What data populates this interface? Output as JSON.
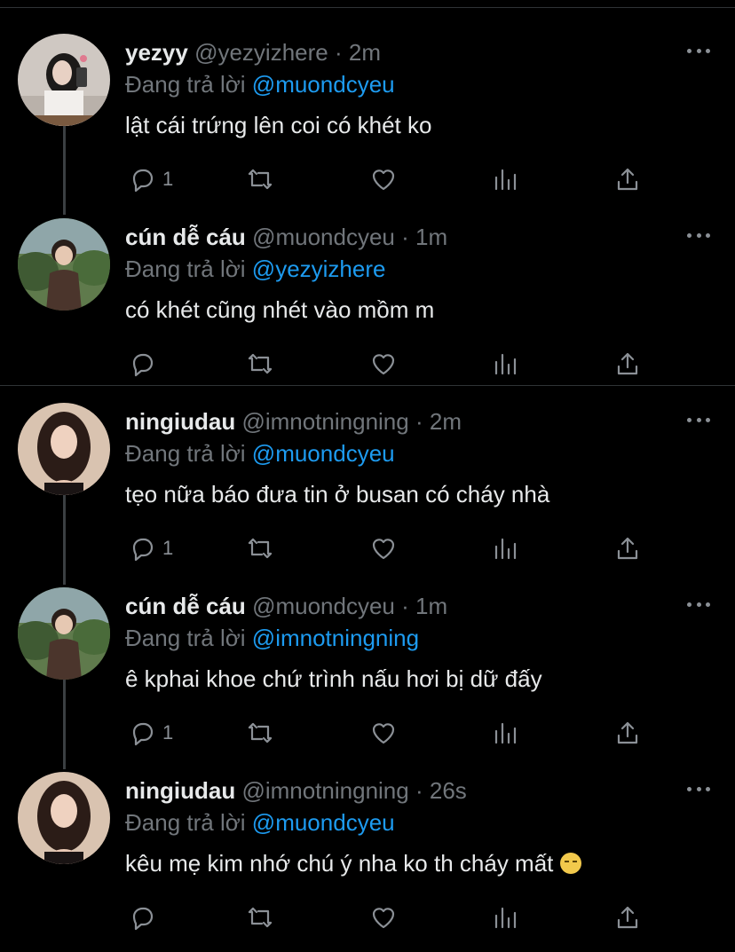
{
  "tweets": [
    {
      "name": "yezyy",
      "handle": "@yezyizhere",
      "dot": "·",
      "time": "2m",
      "replying_prefix": "Đang trả lời",
      "replying_to": "@muondcyeu",
      "text": "lật cái trứng lên coi có khét ko",
      "reply_count": "1",
      "avatar": "woman-selfie-avatar"
    },
    {
      "name": "cún dễ cáu",
      "handle": "@muondcyeu",
      "dot": "·",
      "time": "1m",
      "replying_prefix": "Đang trả lời",
      "replying_to": "@yezyizhere",
      "text": "có khét cũng nhét vào mồm m",
      "reply_count": "",
      "avatar": "child-avatar"
    },
    {
      "name": "ningiudau",
      "handle": "@imnotningning",
      "dot": "·",
      "time": "2m",
      "replying_prefix": "Đang trả lời",
      "replying_to": "@muondcyeu",
      "text": "tẹo nữa báo đưa tin ở busan có cháy nhà",
      "reply_count": "1",
      "avatar": "woman-portrait-avatar"
    },
    {
      "name": "cún dễ cáu",
      "handle": "@muondcyeu",
      "dot": "·",
      "time": "1m",
      "replying_prefix": "Đang trả lời",
      "replying_to": "@imnotningning",
      "text": "ê kphai khoe chứ trình nấu hơi bị dữ đấy",
      "reply_count": "1",
      "avatar": "child-avatar"
    },
    {
      "name": "ningiudau",
      "handle": "@imnotningning",
      "dot": "·",
      "time": "26s",
      "replying_prefix": "Đang trả lời",
      "replying_to": "@muondcyeu",
      "text": "kêu mẹ kim nhớ chú ý nha ko th cháy mất",
      "reply_count": "",
      "avatar": "woman-portrait-avatar",
      "emoji": "downcast-sweat-emoji"
    }
  ],
  "colors": {
    "background": "#000000",
    "text": "#e7e9ea",
    "muted": "#71767b",
    "mention": "#1d9bf0"
  }
}
